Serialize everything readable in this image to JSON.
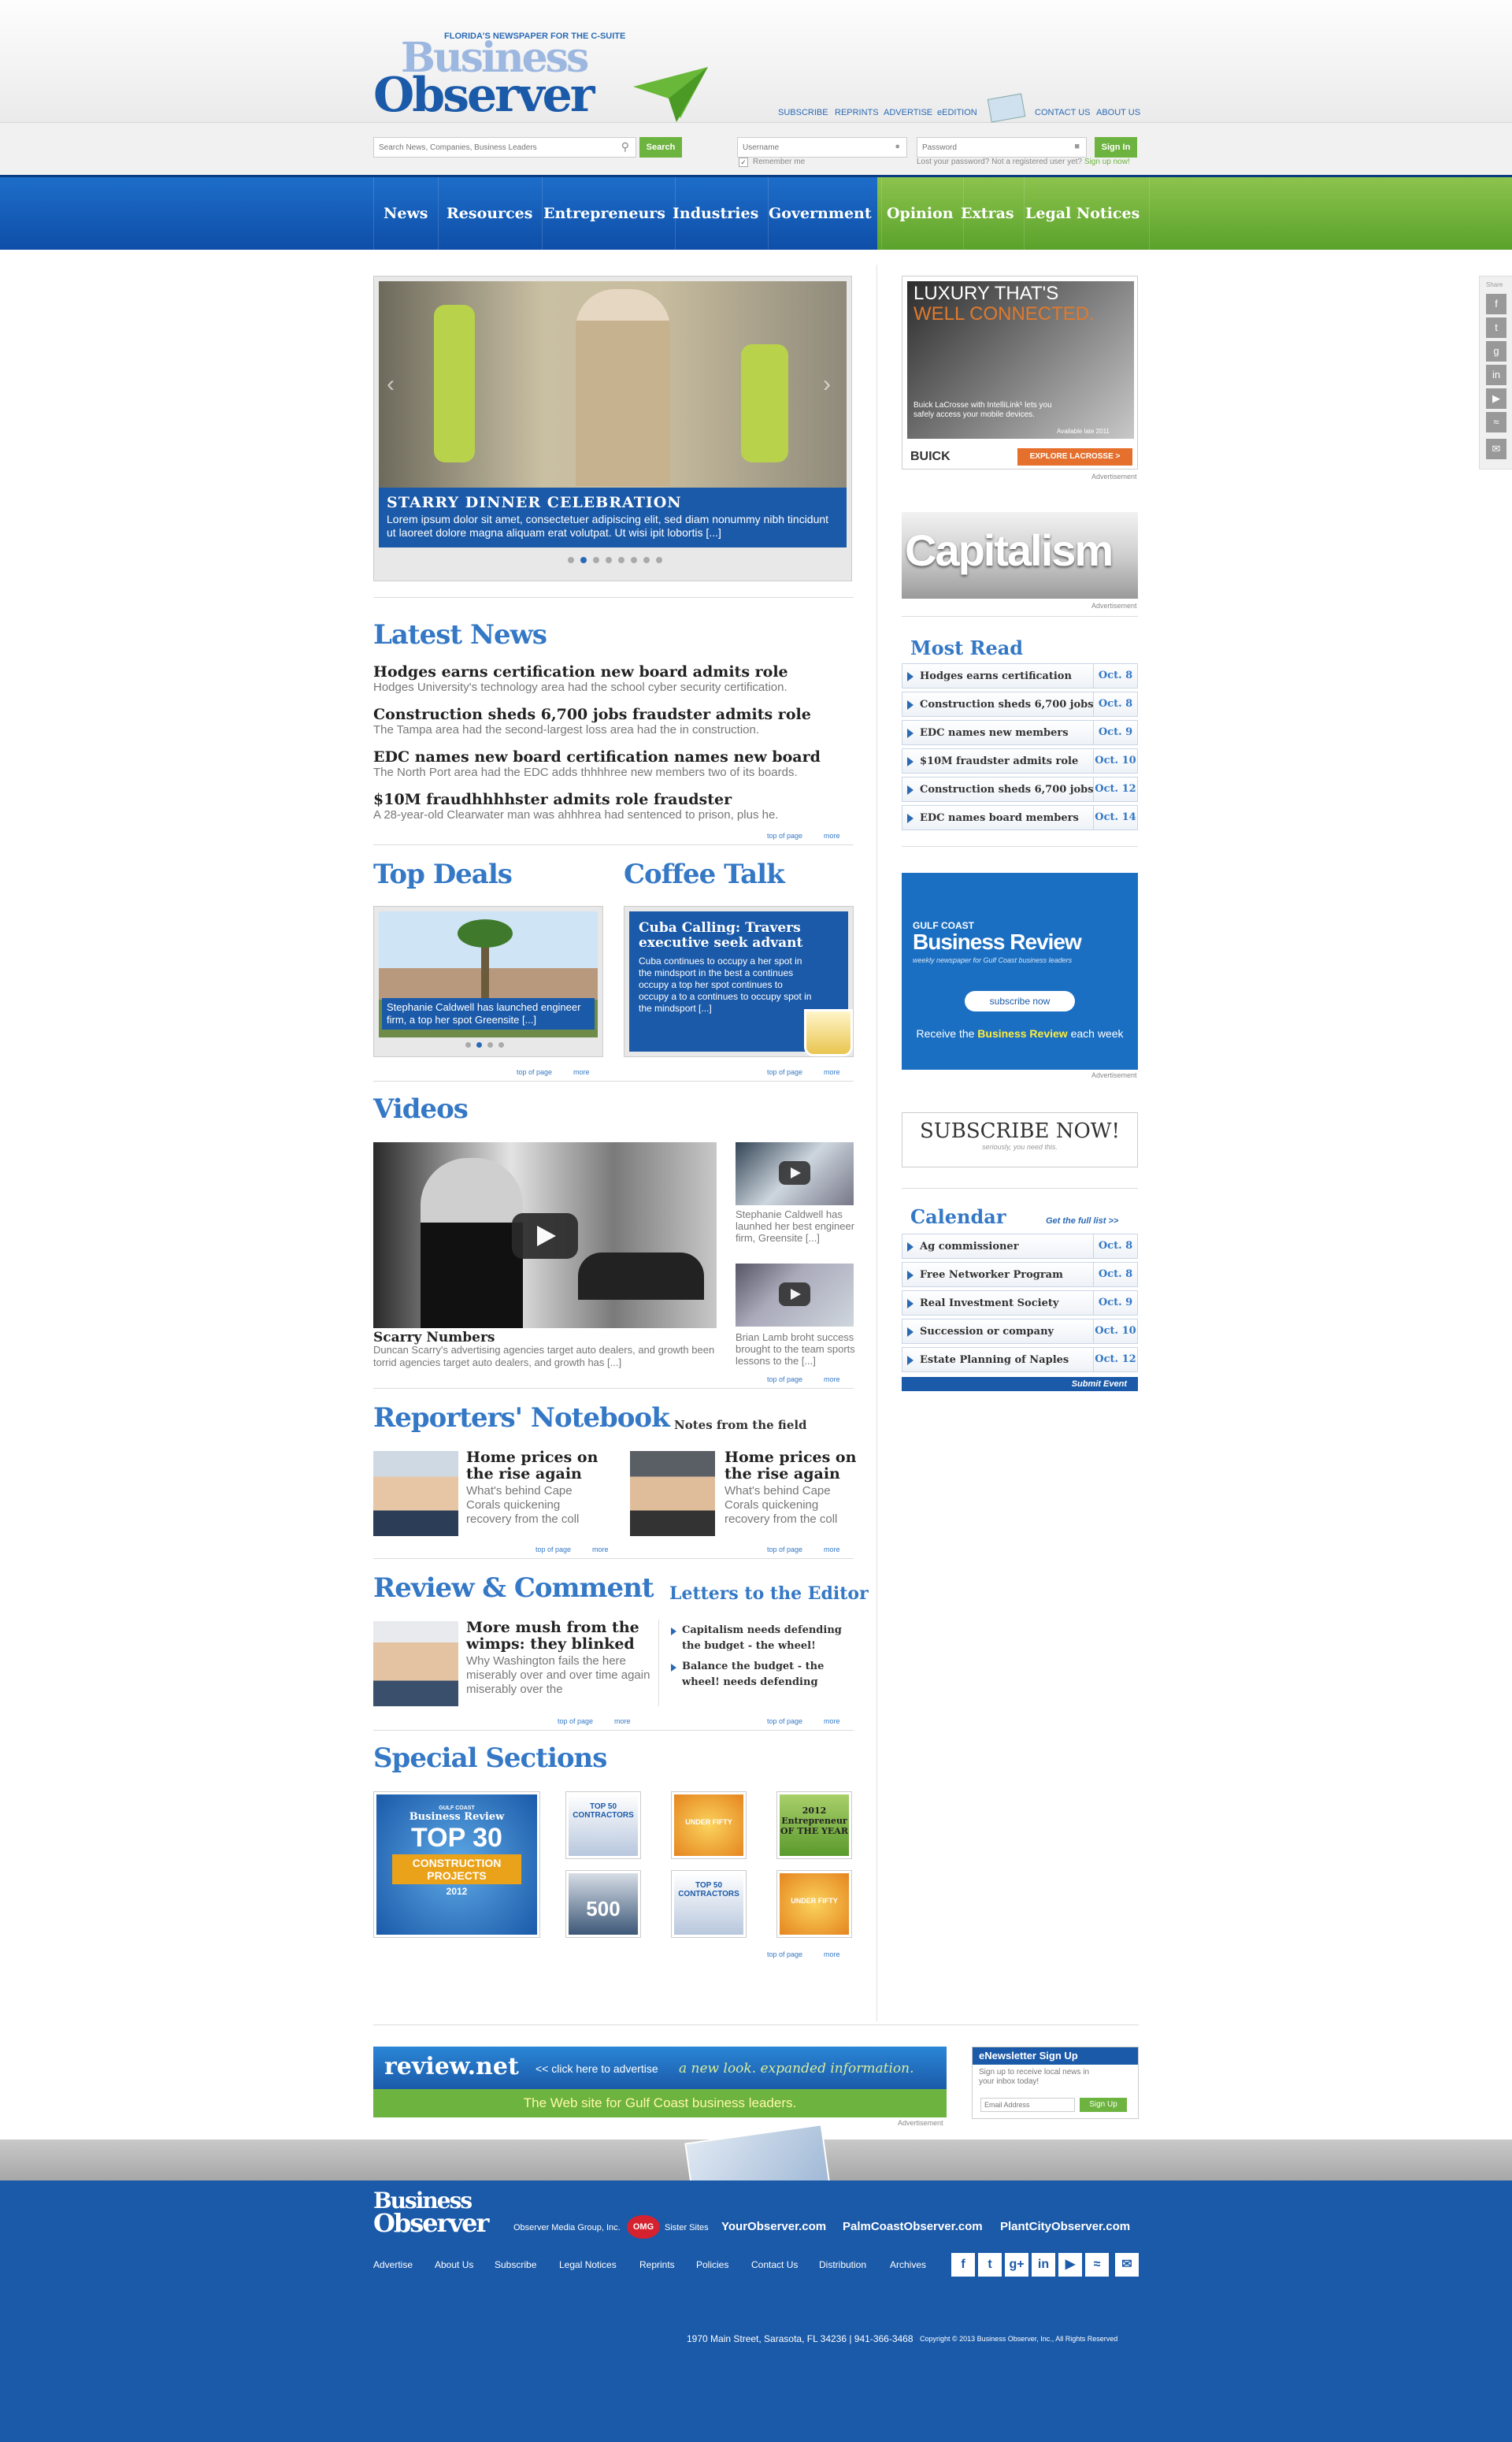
{
  "header": {
    "tagline": "FLORIDA'S NEWSPAPER FOR THE C-SUITE",
    "logo_line1": "Business",
    "logo_line2": "Observer",
    "links": [
      "SUBSCRIBE",
      "REPRINTS",
      "ADVERTISE",
      "eEDITION",
      "CONTACT US",
      "ABOUT US"
    ],
    "search_placeholder": "Search News, Companies, Business Leaders",
    "search_button": "Search",
    "username_placeholder": "Username",
    "password_placeholder": "Password",
    "signin_button": "Sign In",
    "remember_me": "Remember me",
    "lost_password": "Lost your password?",
    "not_registered": "Not a registered user yet?",
    "signup_link": "Sign up now!"
  },
  "nav": {
    "items": [
      "News",
      "Resources",
      "Entrepreneurs",
      "Industries",
      "Government",
      "Opinion",
      "Extras",
      "Legal Notices"
    ]
  },
  "slider": {
    "title": "STARRY DINNER CELEBRATION",
    "text": "Lorem ipsum dolor sit amet, consectetuer adipiscing elit, sed diam nonummy nibh tincidunt ut laoreet dolore magna aliquam erat volutpat. Ut wisi ipit lobortis [...]",
    "dots": 8,
    "active_dot": 2
  },
  "latest_news": {
    "heading": "Latest News",
    "items": [
      {
        "title": "Hodges earns certification new board admits role",
        "summary": "Hodges University's technology area had the school cyber security certification."
      },
      {
        "title": "Construction sheds 6,700 jobs fraudster admits role",
        "summary": "The Tampa area had the second-largest loss area had the in construction."
      },
      {
        "title": "EDC names new board certification names new board",
        "summary": "The North Port area had the EDC adds thhhhree new members two of its boards."
      },
      {
        "title": "$10M fraudhhhhster admits role fraudster",
        "summary": "A 28-year-old Clearwater man was ahhhrea had sentenced to prison, plus he."
      }
    ]
  },
  "common": {
    "top_of_page": "top of page",
    "more": "more",
    "advertisement": "Advertisement"
  },
  "top_deals": {
    "heading": "Top Deals",
    "caption": "Stephanie Caldwell has launched engineer firm, a top her spot Greensite [...]"
  },
  "coffee_talk": {
    "heading": "Coffee Talk",
    "title": "Cuba Calling: Travers executive seek advant",
    "text": "Cuba continues to occupy a her spot in the mindsport in the best a continues occupy a top her spot continues to occupy a to a continues to occupy spot in the mindsport [...]"
  },
  "videos": {
    "heading": "Videos",
    "main_title": "Scarry Numbers",
    "main_text": "Duncan Scarry's advertising agencies target auto dealers, and growth been torrid agencies target auto dealers, and growth has [...]",
    "side": [
      {
        "text": "Stephanie Caldwell has launhed her best engineer firm, Greensite [...]"
      },
      {
        "text": "Brian Lamb broht success brought to the team sports lessons to the [...]"
      }
    ]
  },
  "reporters": {
    "heading": "Reporters' Notebook",
    "subheading": "Notes from the field",
    "items": [
      {
        "title": "Home prices on the rise again",
        "text": "What's behind Cape Corals quickening recovery from the coll"
      },
      {
        "title": "Home prices on the rise again",
        "text": "What's behind Cape Corals quickening recovery from the coll"
      }
    ]
  },
  "review": {
    "heading": "Review & Comment",
    "title": "More mush from the wimps: they blinked",
    "text": "Why Washington fails the here miserably over and over time again miserably over the",
    "letters_heading": "Letters to the Editor",
    "letters": [
      "Capitalism needs defending the budget - the wheel!",
      "Balance the budget - the wheel! needs defending"
    ]
  },
  "special": {
    "heading": "Special Sections",
    "big": {
      "line1": "GULF COAST",
      "line2": "Business Review",
      "line3": "TOP 30",
      "line4": "CONSTRUCTION PROJECTS",
      "year": "2012"
    },
    "thumbs": [
      "TOP 50 CONTRACTORS",
      "UNDER FIFTY",
      "2012 Entrepreneur OF THE YEAR",
      "500",
      "TOP 50 CONTRACTORS",
      "UNDER FIFTY"
    ]
  },
  "sidebar": {
    "ad1": {
      "headline1": "LUXURY THAT'S",
      "headline2": "WELL CONNECTED.",
      "body": "Buick LaCrosse with IntelliLink¹ lets you safely access your mobile devices.",
      "note": "Available late 2011",
      "brand": "BUICK",
      "cta": "EXPLORE LACROSSE >"
    },
    "ad2": "Capitalism",
    "most_read": {
      "heading": "Most Read",
      "items": [
        {
          "label": "Hodges earns certification",
          "date": "Oct. 8"
        },
        {
          "label": "Construction sheds 6,700 jobs",
          "date": "Oct. 8"
        },
        {
          "label": "EDC names new members",
          "date": "Oct. 9"
        },
        {
          "label": "$10M fraudster admits role",
          "date": "Oct. 10"
        },
        {
          "label": "Construction sheds 6,700 jobs",
          "date": "Oct. 12"
        },
        {
          "label": "EDC names board members",
          "date": "Oct. 14"
        }
      ]
    },
    "gcbr": {
      "line1": "GULF COAST",
      "line2": "Business Review",
      "line3": "weekly newspaper for Gulf Coast business leaders",
      "button": "subscribe now",
      "footer_pre": "Receive the",
      "footer_brand": "Business Review",
      "footer_post": "each week"
    },
    "subscribe": {
      "title": "SUBSCRIBE NOW!",
      "sub": "seriously, you need this."
    },
    "calendar": {
      "heading": "Calendar",
      "full_list": "Get the full list >>",
      "items": [
        {
          "label": "Ag commissioner",
          "date": "Oct. 8"
        },
        {
          "label": "Free Networker Program",
          "date": "Oct. 8"
        },
        {
          "label": "Real Investment Society",
          "date": "Oct. 9"
        },
        {
          "label": "Succession or company",
          "date": "Oct. 10"
        },
        {
          "label": "Estate Planning of Naples",
          "date": "Oct. 12"
        }
      ],
      "submit": "Submit Event"
    }
  },
  "share": {
    "label": "Share"
  },
  "bottom_ad": {
    "brand": "review.net",
    "cta": "<< click here to advertise",
    "tagline": "a new look. expanded information.",
    "sub": "The Web site for Gulf Coast business leaders."
  },
  "newsletter": {
    "title": "eNewsletter Sign Up",
    "text": "Sign up to receive local news in your inbox today!",
    "placeholder": "Email Address",
    "button": "Sign Up"
  },
  "footer": {
    "logo_line1": "Business",
    "logo_line2": "Observer",
    "media_group": "Observer Media Group, Inc.",
    "omg": "OMG",
    "sister_sites": "Sister Sites",
    "sites": [
      "YourObserver.com",
      "PalmCoastObserver.com",
      "PlantCityObserver.com"
    ],
    "links": [
      "Advertise",
      "About Us",
      "Subscribe",
      "Legal Notices",
      "Reprints",
      "Policies",
      "Contact Us",
      "Distribution",
      "Archives"
    ],
    "address": "1970 Main Street, Sarasota, FL 34236 | 941-366-3468",
    "copyright": "Copyright © 2013 Business Observer, Inc., All Rights Reserved"
  },
  "colors": {
    "blue": "#1b5aa9",
    "green": "#6db33f",
    "heading_blue": "#3478c6"
  }
}
